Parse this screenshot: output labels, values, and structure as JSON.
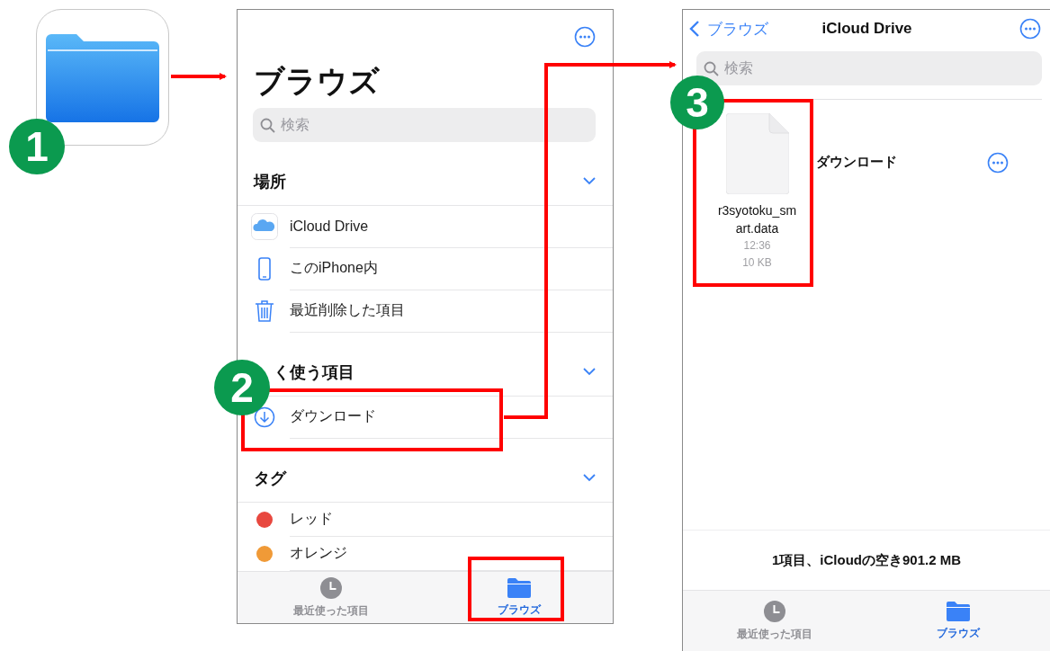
{
  "app_icon": {
    "badge": "1"
  },
  "browse_screen": {
    "title": "ブラウズ",
    "search": {
      "placeholder": "検索"
    },
    "sections": [
      {
        "title": "場所",
        "expanded": true,
        "items": [
          {
            "label": "iCloud Drive",
            "kind": "icloud"
          },
          {
            "label": "このiPhone内",
            "kind": "iphone"
          },
          {
            "label": "最近削除した項目",
            "kind": "trash"
          }
        ]
      },
      {
        "title": "く使う項目",
        "badge": "2",
        "expanded": true,
        "items": [
          {
            "label": "ダウンロード",
            "kind": "download"
          }
        ]
      },
      {
        "title": "タグ",
        "expanded": true,
        "items": [
          {
            "label": "レッド",
            "kind": "tag",
            "color": "#e8483f"
          },
          {
            "label": "オレンジ",
            "kind": "tag",
            "color": "#f09a37"
          }
        ]
      }
    ],
    "tab_bar": [
      {
        "label": "最近使った項目",
        "kind": "recents",
        "selected": false
      },
      {
        "label": "ブラウズ",
        "kind": "browse",
        "selected": true
      }
    ]
  },
  "icloud_screen": {
    "back": "ブラウズ",
    "title": "iCloud Drive",
    "search": {
      "placeholder": "検索"
    },
    "badge": "3",
    "files": [
      {
        "name": "r3syotoku_smart.data",
        "time": "12:36",
        "size": "10 KB"
      }
    ],
    "folder_label": "ダウンロード",
    "footer": "1項目、iCloudの空き901.2 MB",
    "tab_bar": [
      {
        "label": "最近使った項目",
        "kind": "recents",
        "selected": false
      },
      {
        "label": "ブラウズ",
        "kind": "browse",
        "selected": true
      }
    ]
  }
}
